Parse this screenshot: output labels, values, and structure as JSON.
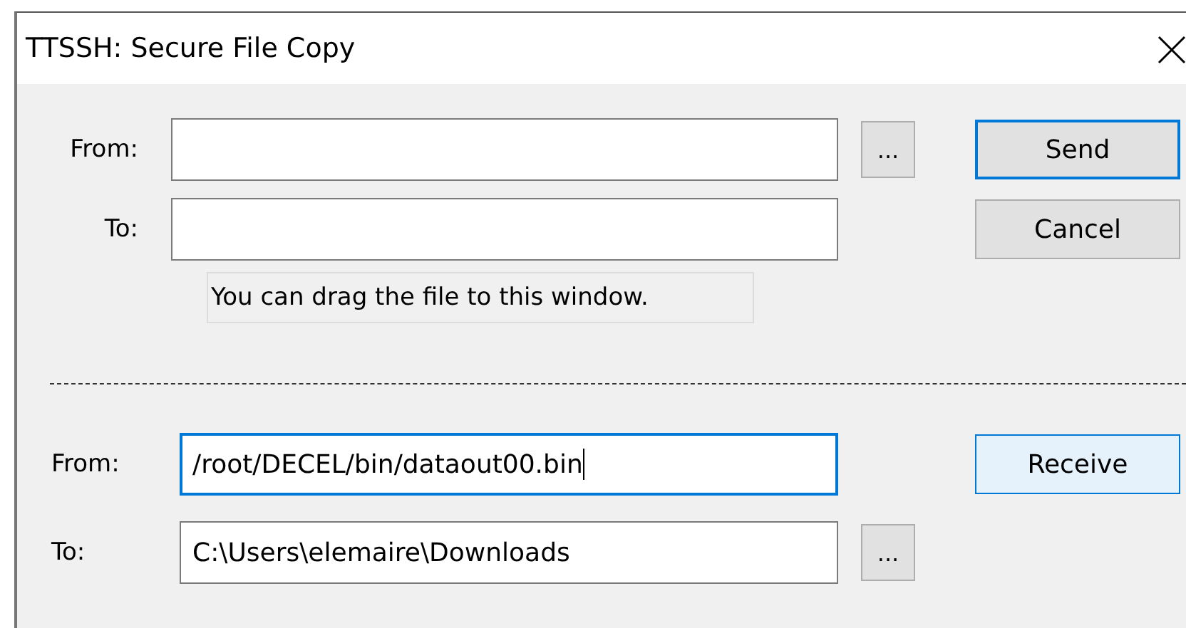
{
  "window": {
    "title": "TTSSH: Secure File Copy"
  },
  "send": {
    "from": {
      "label": "From:",
      "focused": false,
      "browse_button": "..."
    },
    "to": {
      "label": "To:",
      "focused": false
    },
    "buttons": [
      {
        "label": "Send",
        "focused": true,
        "hovered": false
      },
      {
        "label": "Cancel",
        "focused": false,
        "hovered": false
      }
    ],
    "hint": "You can drag the file to this window."
  },
  "receive": {
    "from": {
      "label": "From:",
      "value": "/root/DECEL/bin/dataout00.bin",
      "focused": true
    },
    "to": {
      "label": "To:",
      "value": "C:\\Users\\elemaire\\Downloads",
      "focused": false,
      "browse_button": "..."
    },
    "button": {
      "label": "Receive",
      "focused": false,
      "hovered": true
    }
  }
}
